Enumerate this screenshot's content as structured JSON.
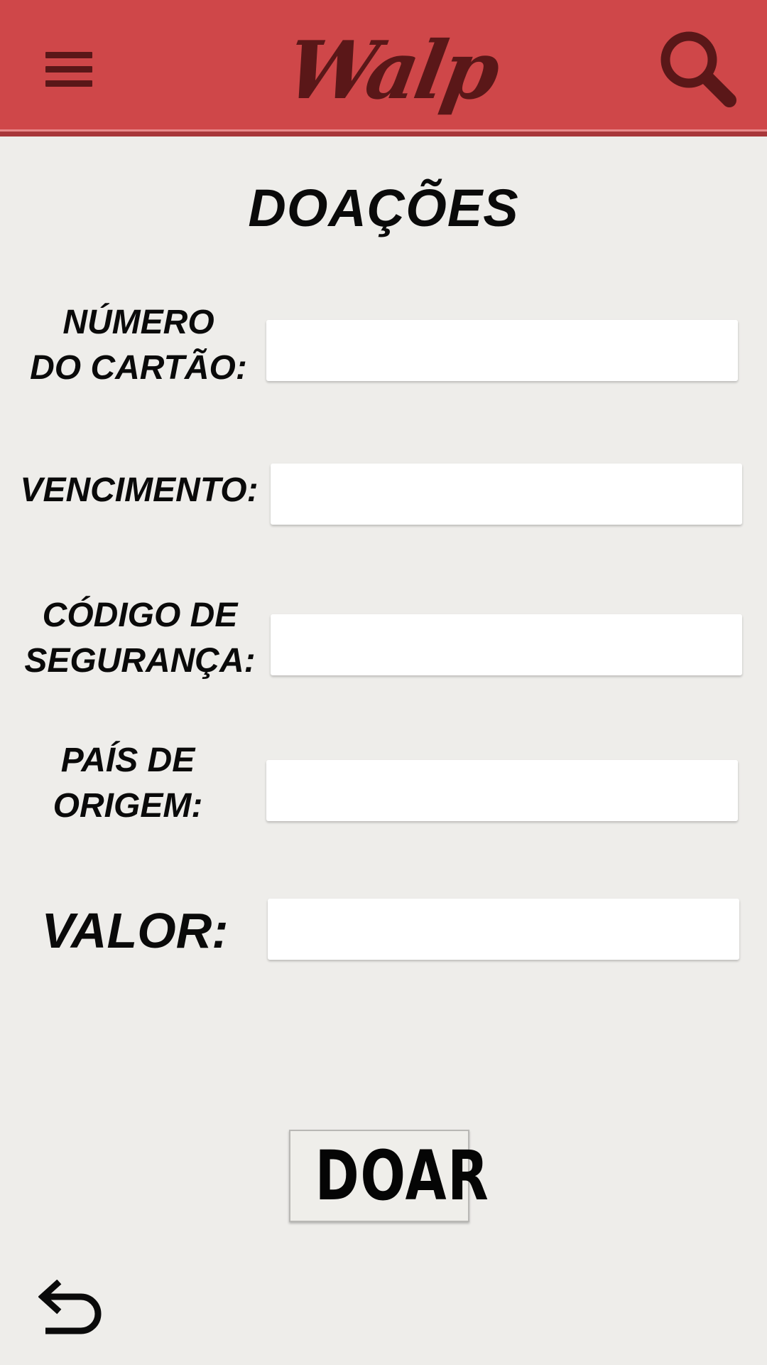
{
  "app_bar": {
    "logo_text": "Walp",
    "menu_icon": "hamburger-menu-icon",
    "search_icon": "search-icon",
    "background_color": "#cf4749",
    "icon_color": "#5a1718"
  },
  "page": {
    "title": "DOAÇÕES",
    "background_color": "#eeedea"
  },
  "form": {
    "fields": [
      {
        "label": "NÚMERO\nDO CARTÃO:",
        "value": "",
        "placeholder": ""
      },
      {
        "label": "VENCIMENTO:",
        "value": "",
        "placeholder": ""
      },
      {
        "label": "CÓDIGO DE\nSEGURANÇA:",
        "value": "",
        "placeholder": ""
      },
      {
        "label": "PAÍS DE\nORIGEM:",
        "value": "",
        "placeholder": ""
      },
      {
        "label": "VALOR:",
        "value": "",
        "placeholder": ""
      }
    ],
    "submit_label": "DOAR"
  },
  "footer": {
    "back_icon": "back-arrow-icon"
  }
}
